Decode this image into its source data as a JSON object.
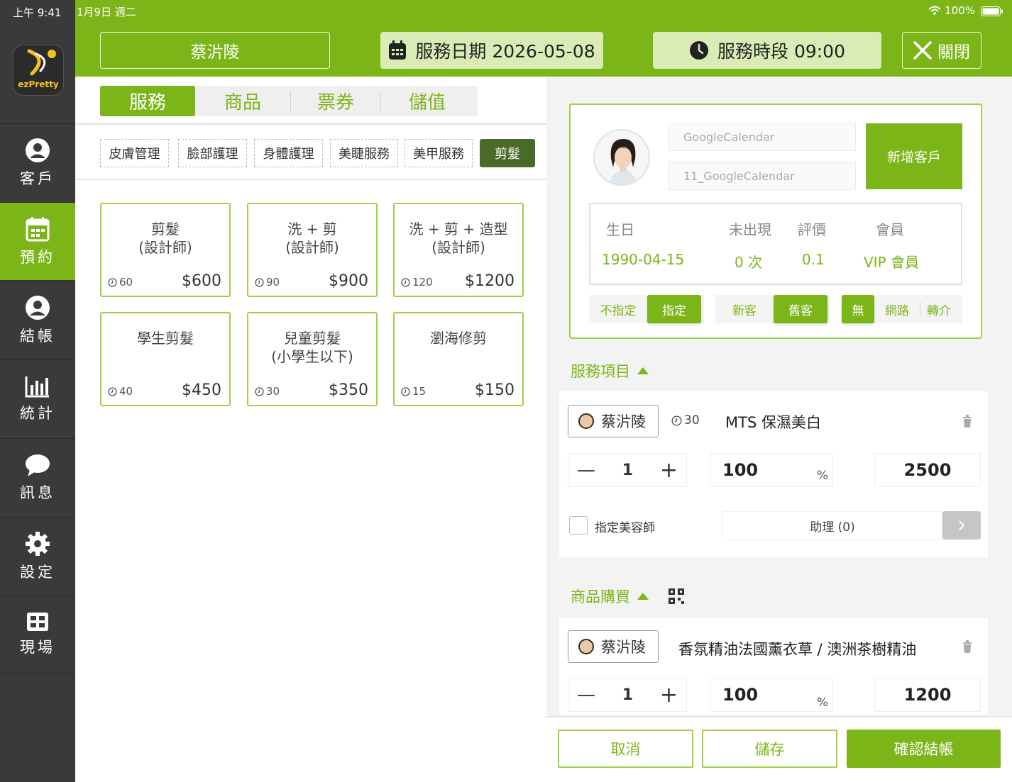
{
  "status_bar": {
    "time": "上午 9:41",
    "date": "1月9日 週二",
    "battery": "100%"
  },
  "logo": {
    "text": "ezPretty"
  },
  "nav": [
    {
      "label": "客戶",
      "icon": "user-icon"
    },
    {
      "label": "預約",
      "icon": "calendar-icon"
    },
    {
      "label": "結帳",
      "icon": "user-icon"
    },
    {
      "label": "統計",
      "icon": "bar-chart-icon"
    },
    {
      "label": "訊息",
      "icon": "chat-icon"
    },
    {
      "label": "設定",
      "icon": "gear-icon"
    },
    {
      "label": "現場",
      "icon": "grid-icon"
    }
  ],
  "header": {
    "staff_name": "蔡沜陵",
    "service_date": "服務日期 2026-05-08",
    "service_time": "服務時段 09:00",
    "close_label": "關閉"
  },
  "main_tabs": [
    "服務",
    "商品",
    "票券",
    "儲值"
  ],
  "categories": [
    "皮膚管理",
    "臉部護理",
    "身體護理",
    "美睫服務",
    "美甲服務",
    "剪髮"
  ],
  "services": [
    {
      "name": "剪髮\n(設計師)",
      "duration": "60",
      "price": "$600"
    },
    {
      "name": "洗 + 剪\n(設計師)",
      "duration": "90",
      "price": "$900"
    },
    {
      "name": "洗 + 剪 + 造型\n(設計師)",
      "duration": "120",
      "price": "$1200"
    },
    {
      "name": "學生剪髮",
      "duration": "40",
      "price": "$450"
    },
    {
      "name": "兒童剪髮\n(小學生以下)",
      "duration": "30",
      "price": "$350"
    },
    {
      "name": "瀏海修剪",
      "duration": "15",
      "price": "$150"
    }
  ],
  "customer": {
    "google_calendar_placeholder": "GoogleCalendar",
    "google_calendar_placeholder_2": "11_GoogleCalendar",
    "new_customer_label": "新增客戶",
    "labels": {
      "birthday": "生日",
      "no_show": "未出現",
      "rating": "評價",
      "member": "會員"
    },
    "values": {
      "birthday": "1990-04-15",
      "no_show": "0 次",
      "rating": "0.1",
      "member": "VIP 會員"
    },
    "seg1": [
      "不指定",
      "指定"
    ],
    "seg2": [
      "新客",
      "舊客"
    ],
    "seg3": [
      "無",
      "網路",
      "轉介"
    ]
  },
  "service_section": {
    "title": "服務項目",
    "staff": "蔡沜陵",
    "duration": "30",
    "item_name": "MTS 保濕美白",
    "qty": "1",
    "percent": "100",
    "percent_unit": "%",
    "price": "2500",
    "assign_label": "指定美容師",
    "assistant_label": "助理 (0)"
  },
  "product_section": {
    "title": "商品購買",
    "staff": "蔡沜陵",
    "item_name": "香氛精油法國薰衣草 / 澳洲茶樹精油",
    "qty": "1",
    "percent": "100",
    "percent_unit": "%",
    "price": "1200"
  },
  "bottom": {
    "cancel": "取消",
    "save": "儲存",
    "confirm": "確認結帳"
  },
  "colors": {
    "accent": "#7cb518",
    "sidebar": "#3a3a3a",
    "dark_green": "#4a6a2a"
  }
}
